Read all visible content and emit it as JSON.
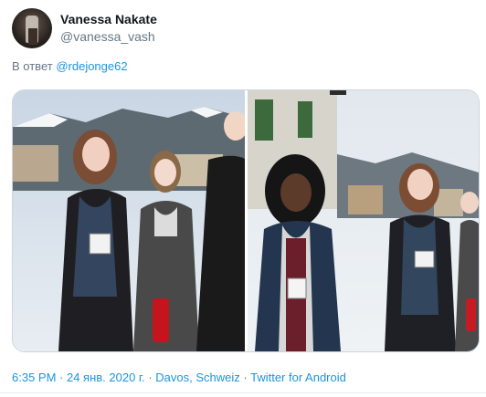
{
  "tweet": {
    "display_name": "Vanessa Nakate",
    "handle": "@vanessa_vash",
    "reply_prefix": "В ответ",
    "reply_to": "@rdejonge62",
    "time": "6:35 PM",
    "sep1": " · ",
    "date": "24 янв. 2020 г.",
    "sep2": " · ",
    "location": "Davos, Schweiz",
    "sep3": " · ",
    "source": "Twitter for Android"
  },
  "colors": {
    "link": "#1b95e0",
    "secondary_text": "#657786",
    "primary_text": "#14171a"
  },
  "icons": [
    "avatar-photo",
    "more-options-icon"
  ],
  "media": [
    {
      "kind": "photo",
      "subject": "left-photo"
    },
    {
      "kind": "photo",
      "subject": "right-photo"
    }
  ]
}
